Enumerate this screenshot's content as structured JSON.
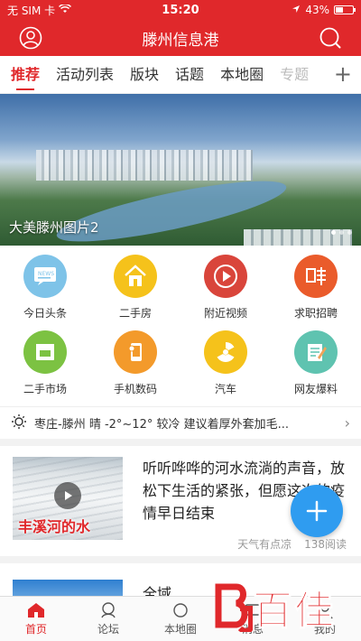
{
  "status_bar": {
    "carrier": "无 SIM 卡",
    "time": "15:20",
    "battery": "43%",
    "battery_level": 0.43
  },
  "header": {
    "title": "滕州信息港"
  },
  "tabs": [
    {
      "label": "推荐",
      "active": true
    },
    {
      "label": "活动列表"
    },
    {
      "label": "版块"
    },
    {
      "label": "话题"
    },
    {
      "label": "本地圈"
    },
    {
      "label": "专题"
    }
  ],
  "banner": {
    "caption": "大美滕州图片2",
    "slides": 3,
    "current": 1
  },
  "quick_links": [
    {
      "label": "今日头条",
      "icon": "news-icon",
      "color": "#7ec3e8"
    },
    {
      "label": "二手房",
      "icon": "house-icon",
      "color": "#f5c21b"
    },
    {
      "label": "附近视频",
      "icon": "video-play-icon",
      "color": "#d9453b"
    },
    {
      "label": "求职招聘",
      "icon": "recruit-icon",
      "color": "#ea5b2b"
    },
    {
      "label": "二手市场",
      "icon": "market-icon",
      "color": "#7cc242"
    },
    {
      "label": "手机数码",
      "icon": "phone-touch-icon",
      "color": "#f39a2b"
    },
    {
      "label": "汽车",
      "icon": "car-icon",
      "color": "#f5c21b"
    },
    {
      "label": "网友爆料",
      "icon": "edit-note-icon",
      "color": "#5fc3b0"
    }
  ],
  "weather": {
    "text": "枣庄-滕州 晴 -2°~12° 较冷 建议着厚外套加毛..."
  },
  "news": [
    {
      "headline": "听听哗哗的河水流淌的声音，放松下生活的紧张，但愿这次的疫情早日结束",
      "thumb_overlay": "丰溪河的水",
      "author": "天气有点凉",
      "reads": "138阅读"
    },
    {
      "headline": "全域..."
    }
  ],
  "bottom_nav": [
    {
      "label": "首页",
      "active": true
    },
    {
      "label": "论坛"
    },
    {
      "label": "本地圈"
    },
    {
      "label": "消息"
    },
    {
      "label": "我的"
    }
  ],
  "watermark": {
    "text": "百佳"
  },
  "colors": {
    "brand_red": "#e0282b",
    "fab_blue": "#2f9cf0"
  }
}
